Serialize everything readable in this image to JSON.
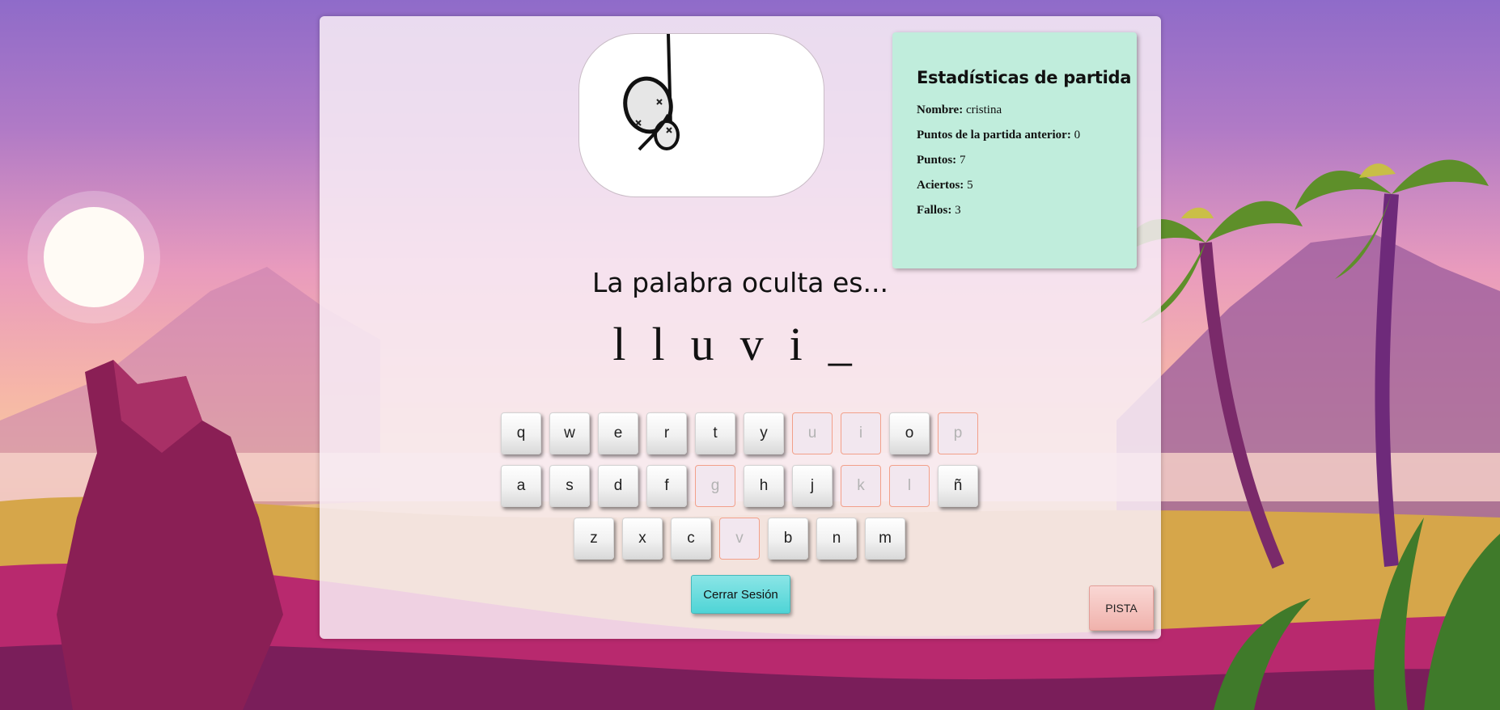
{
  "stats": {
    "title": "Estadísticas de partida",
    "name_label": "Nombre:",
    "name_value": "cristina",
    "prev_points_label": "Puntos de la partida anterior:",
    "prev_points_value": "0",
    "points_label": "Puntos:",
    "points_value": "7",
    "hits_label": "Aciertos:",
    "hits_value": "5",
    "misses_label": "Fallos:",
    "misses_value": "3"
  },
  "game": {
    "prompt": "La palabra oculta es...",
    "word_slots": [
      "l",
      "l",
      "u",
      "v",
      "i",
      "_"
    ]
  },
  "keyboard": {
    "rows": [
      [
        {
          "letter": "q",
          "used": false
        },
        {
          "letter": "w",
          "used": false
        },
        {
          "letter": "e",
          "used": false
        },
        {
          "letter": "r",
          "used": false
        },
        {
          "letter": "t",
          "used": false
        },
        {
          "letter": "y",
          "used": false
        },
        {
          "letter": "u",
          "used": true
        },
        {
          "letter": "i",
          "used": true
        },
        {
          "letter": "o",
          "used": false
        },
        {
          "letter": "p",
          "used": true
        }
      ],
      [
        {
          "letter": "a",
          "used": false
        },
        {
          "letter": "s",
          "used": false
        },
        {
          "letter": "d",
          "used": false
        },
        {
          "letter": "f",
          "used": false
        },
        {
          "letter": "g",
          "used": true
        },
        {
          "letter": "h",
          "used": false
        },
        {
          "letter": "j",
          "used": false
        },
        {
          "letter": "k",
          "used": true
        },
        {
          "letter": "l",
          "used": true
        },
        {
          "letter": "ñ",
          "used": false
        }
      ],
      [
        {
          "letter": "z",
          "used": false
        },
        {
          "letter": "x",
          "used": false
        },
        {
          "letter": "c",
          "used": false
        },
        {
          "letter": "v",
          "used": true
        },
        {
          "letter": "b",
          "used": false
        },
        {
          "letter": "n",
          "used": false
        },
        {
          "letter": "m",
          "used": false
        }
      ]
    ]
  },
  "buttons": {
    "logout": "Cerrar Sesión",
    "hint": "PISTA"
  },
  "hangman": {
    "icon": "hangman-head-icon"
  },
  "colors": {
    "stats_bg": "#c0eddc",
    "logout_bg": "#4fd4d6",
    "hint_bg": "#f0b2ac",
    "used_key_border": "#f2a08a"
  }
}
